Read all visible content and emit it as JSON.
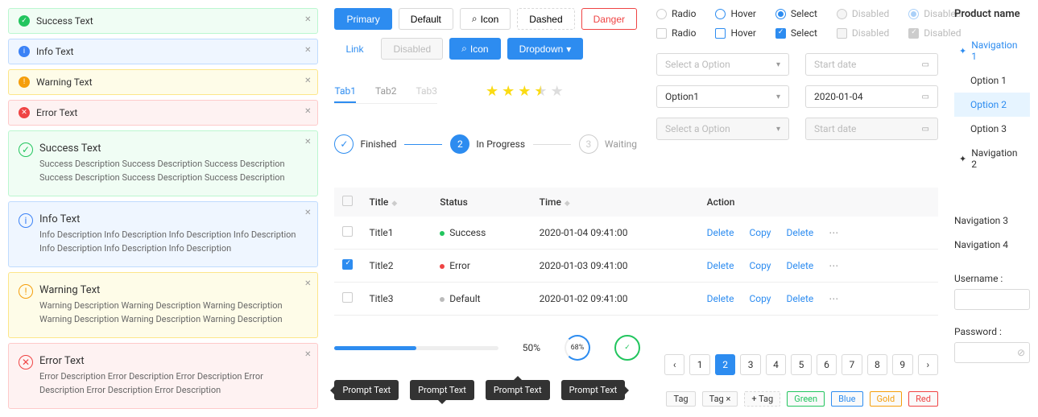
{
  "alerts_small": [
    {
      "type": "success",
      "text": "Success Text"
    },
    {
      "type": "info",
      "text": "Info Text"
    },
    {
      "type": "warning",
      "text": "Warning Text"
    },
    {
      "type": "error",
      "text": "Error Text"
    }
  ],
  "alerts_large": [
    {
      "type": "success",
      "title": "Success Text",
      "desc": "Success Description Success Description Success Description Success Description Success Description Success Description"
    },
    {
      "type": "info",
      "title": "Info Text",
      "desc": "Info Description Info Description Info Description Info Description Info Description Info Description Info Description"
    },
    {
      "type": "warning",
      "title": "Warning Text",
      "desc": "Warning Description Warning Description Warning Description Warning Description Warning Description Warning Description"
    },
    {
      "type": "error",
      "title": "Error Text",
      "desc": "Error Description Error Description Error Description Error Description Error Description Error Description"
    }
  ],
  "buttons_row1": {
    "primary": "Primary",
    "default": "Default",
    "icon": "Icon",
    "dashed": "Dashed",
    "danger": "Danger"
  },
  "buttons_row2": {
    "link": "Link",
    "disabled": "Disabled",
    "icon": "Icon",
    "dropdown": "Dropdown"
  },
  "tabs": {
    "t1": "Tab1",
    "t2": "Tab2",
    "t3": "Tab3"
  },
  "rating": 3.5,
  "steps": {
    "s1": "Finished",
    "s2": "In Progress",
    "s3": "Waiting",
    "n2": "2",
    "n3": "3"
  },
  "radios": {
    "radio": "Radio",
    "hover": "Hover",
    "select": "Select",
    "disabled": "Disabled"
  },
  "selects": {
    "placeholder": "Select a Option",
    "date_placeholder": "Start date",
    "option1": "Option1",
    "date1": "2020-01-04"
  },
  "table": {
    "columns": {
      "title": "Title",
      "status": "Status",
      "time": "Time",
      "action": "Action"
    },
    "actions": {
      "delete": "Delete",
      "copy": "Copy"
    },
    "rows": [
      {
        "title": "Title1",
        "status": "success",
        "status_label": "Success",
        "time": "2020-01-04  09:41:00",
        "checked": false
      },
      {
        "title": "Title2",
        "status": "error",
        "status_label": "Error",
        "time": "2020-01-03  09:41:00",
        "checked": true
      },
      {
        "title": "Title3",
        "status": "default",
        "status_label": "Default",
        "time": "2020-01-02  09:41:00",
        "checked": false
      }
    ]
  },
  "progress": {
    "bar": "50%",
    "circle": "68%"
  },
  "pagination": {
    "pages": [
      "1",
      "2",
      "3",
      "4",
      "5",
      "6",
      "7",
      "8",
      "9"
    ],
    "active": 2
  },
  "tags": {
    "plain": "Tag",
    "closable": "Tag ×",
    "add": "+  Tag",
    "green": "Green",
    "blue": "Blue",
    "gold": "Gold",
    "red": "Red"
  },
  "prompts": [
    "Prompt Text",
    "Prompt Text",
    "Prompt Text",
    "Prompt Text"
  ],
  "nav": {
    "title": "Product name",
    "n1": "Navigation 1",
    "o1": "Option 1",
    "o2": "Option 2",
    "o3": "Option 3",
    "n2": "Navigation 2",
    "n3": "Navigation 3",
    "n4": "Navigation 4"
  },
  "form": {
    "username": "Username :",
    "password": "Password :"
  }
}
